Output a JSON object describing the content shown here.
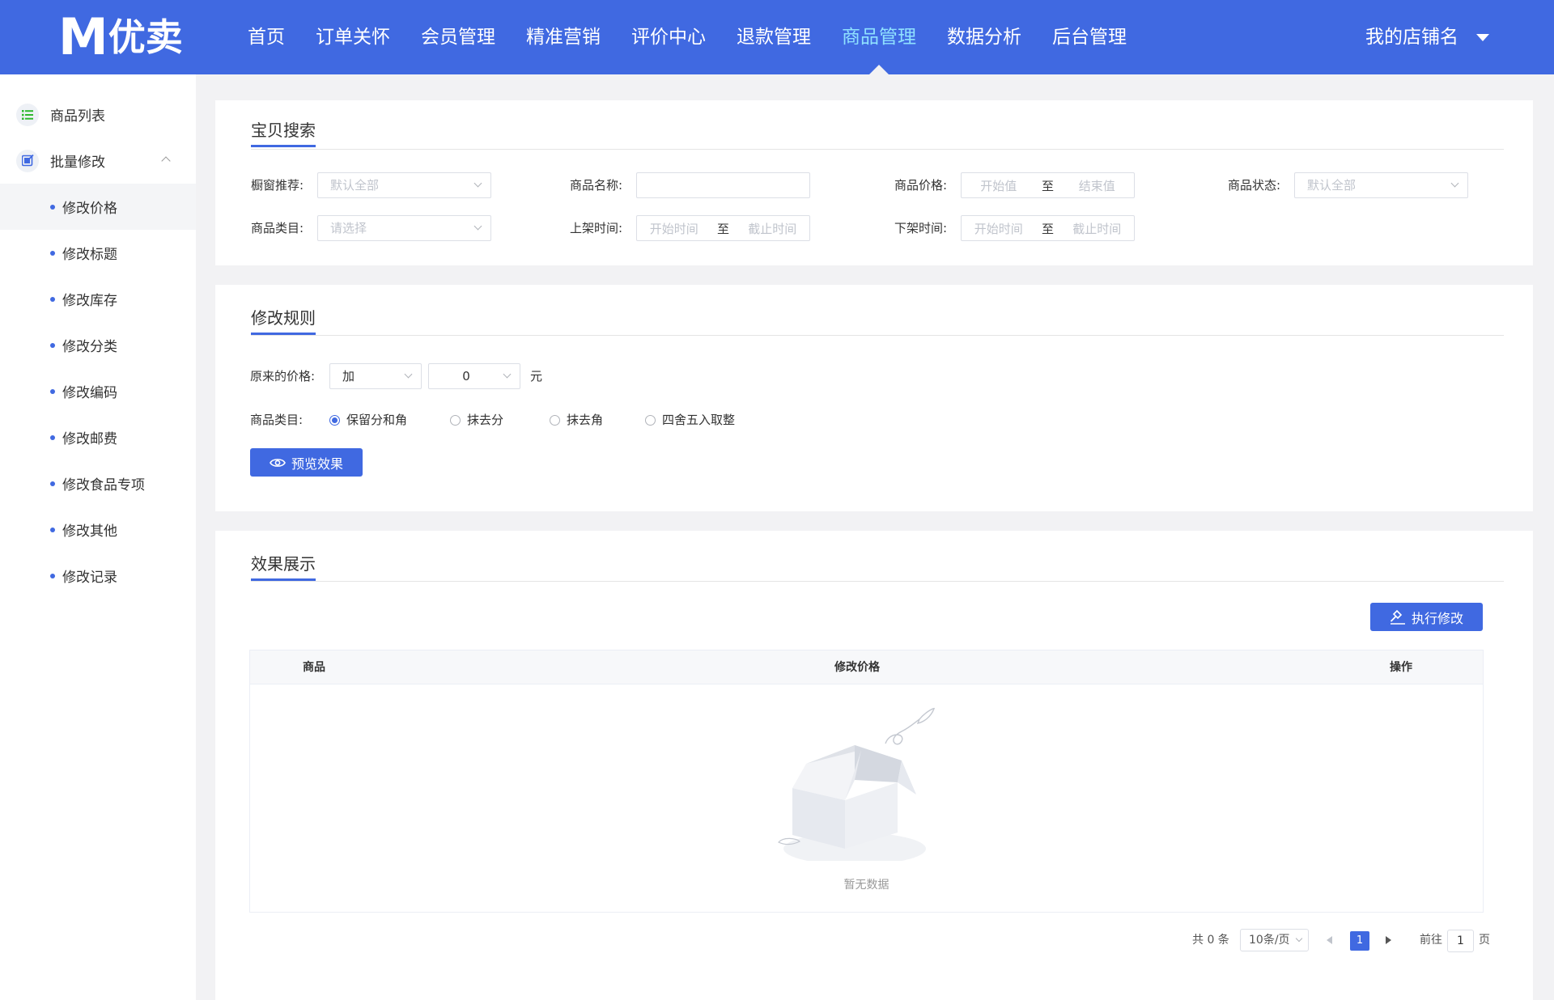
{
  "header": {
    "logo_letter": "M",
    "logo_text": "优卖",
    "nav": [
      {
        "label": "首页"
      },
      {
        "label": "订单关怀"
      },
      {
        "label": "会员管理"
      },
      {
        "label": "精准营销"
      },
      {
        "label": "评价中心"
      },
      {
        "label": "退款管理"
      },
      {
        "label": "商品管理",
        "active": true
      },
      {
        "label": "数据分析"
      },
      {
        "label": "后台管理"
      }
    ],
    "shop_name": "我的店铺名"
  },
  "sidebar": {
    "groups": [
      {
        "label": "商品列表",
        "icon": "list-icon"
      },
      {
        "label": "批量修改",
        "icon": "edit-icon",
        "expanded": true
      }
    ],
    "sub_items": [
      {
        "label": "修改价格",
        "active": true
      },
      {
        "label": "修改标题"
      },
      {
        "label": "修改库存"
      },
      {
        "label": "修改分类"
      },
      {
        "label": "修改编码"
      },
      {
        "label": "修改邮费"
      },
      {
        "label": "修改食品专项"
      },
      {
        "label": "修改其他"
      },
      {
        "label": "修改记录"
      }
    ]
  },
  "search": {
    "title": "宝贝搜索",
    "window_label": "橱窗推荐:",
    "window_placeholder": "默认全部",
    "name_label": "商品名称:",
    "name_value": "",
    "price_label": "商品价格:",
    "price_start": "开始值",
    "price_sep": "至",
    "price_end": "结束值",
    "status_label": "商品状态:",
    "status_placeholder": "默认全部",
    "category_label": "商品类目:",
    "category_placeholder": "请选择",
    "on_label": "上架时间:",
    "on_start": "开始时间",
    "on_sep": "至",
    "on_end": "截止时间",
    "off_label": "下架时间:",
    "off_start": "开始时间",
    "off_sep": "至",
    "off_end": "截止时间"
  },
  "rules": {
    "title": "修改规则",
    "price_label": "原来的价格:",
    "operator": "加",
    "amount": "0",
    "unit": "元",
    "category_label": "商品类目:",
    "options": [
      {
        "label": "保留分和角",
        "checked": true
      },
      {
        "label": "抹去分"
      },
      {
        "label": "抹去角"
      },
      {
        "label": "四舍五入取整"
      }
    ],
    "preview_button": "预览效果"
  },
  "result": {
    "title": "效果展示",
    "execute_button": "执行修改",
    "columns": [
      "商品",
      "修改价格",
      "操作"
    ],
    "empty_text": "暂无数据"
  },
  "pagination": {
    "total": "共 0 条",
    "page_size": "10条/页",
    "current": "1",
    "goto_label": "前往",
    "goto_value": "1",
    "page_suffix": "页"
  },
  "colors": {
    "brand": "#4069e1",
    "nav_active": "#8fe1ff"
  }
}
